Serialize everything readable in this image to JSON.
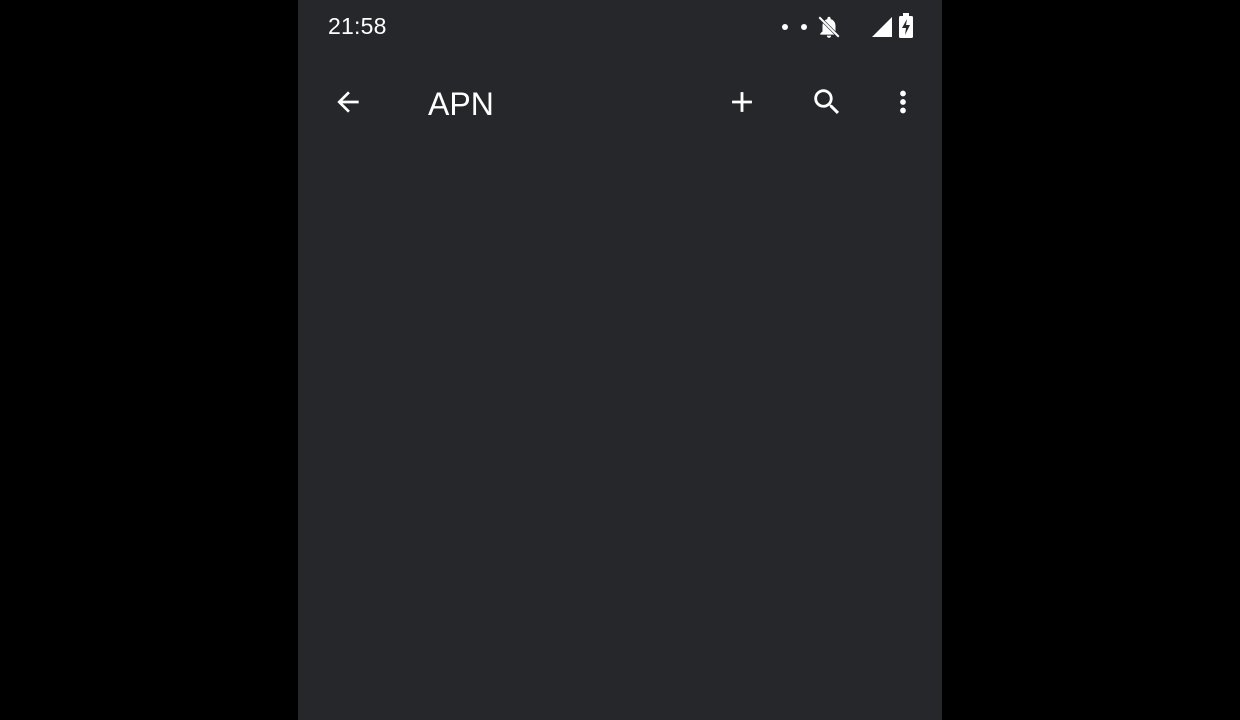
{
  "status_bar": {
    "time": "21:58",
    "icons": [
      "notification-dot",
      "notification-dot",
      "bell-off-icon",
      "signal-icon",
      "battery-charging-icon"
    ]
  },
  "app_bar": {
    "title": "APN",
    "actions": [
      "arrow-back-icon",
      "add-icon",
      "search-icon",
      "more-vert-icon"
    ]
  },
  "colors": {
    "background": "#25272a",
    "letterbox": "#000000",
    "foreground": "#ffffff"
  }
}
